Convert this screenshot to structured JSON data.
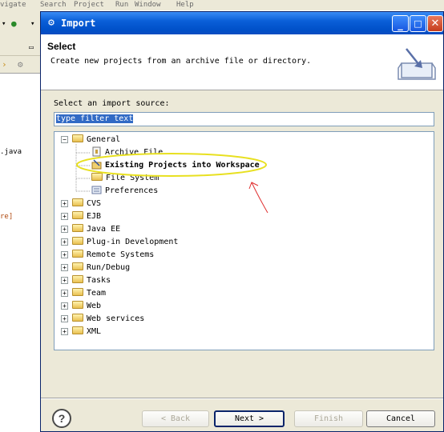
{
  "background": {
    "menu_items": [
      "vigate",
      "Search",
      "Project",
      "Run",
      "Window",
      "Help"
    ],
    "editor_lines": [
      ".java",
      "re]"
    ]
  },
  "dialog": {
    "title": "Import",
    "header": {
      "title": "Select",
      "description": "Create new projects from an archive file or directory."
    },
    "source_label": "Select an import source:",
    "filter": {
      "value": "type filter text"
    },
    "tree": [
      {
        "label": "General",
        "expanded": true,
        "children": [
          "Archive File",
          "Existing Projects into Workspace",
          "File System",
          "Preferences"
        ]
      },
      {
        "label": "CVS"
      },
      {
        "label": "EJB"
      },
      {
        "label": "Java EE"
      },
      {
        "label": "Plug-in Development"
      },
      {
        "label": "Remote Systems"
      },
      {
        "label": "Run/Debug"
      },
      {
        "label": "Tasks"
      },
      {
        "label": "Team"
      },
      {
        "label": "Web"
      },
      {
        "label": "Web services"
      },
      {
        "label": "XML"
      }
    ],
    "buttons": {
      "help": "?",
      "back": "< Back",
      "next": "Next >",
      "finish": "Finish",
      "cancel": "Cancel"
    },
    "colors": {
      "titlebar": "#0a5fd8",
      "selection": "#316ac5",
      "annotation": "#e8e020",
      "arrow": "#e03030"
    }
  }
}
